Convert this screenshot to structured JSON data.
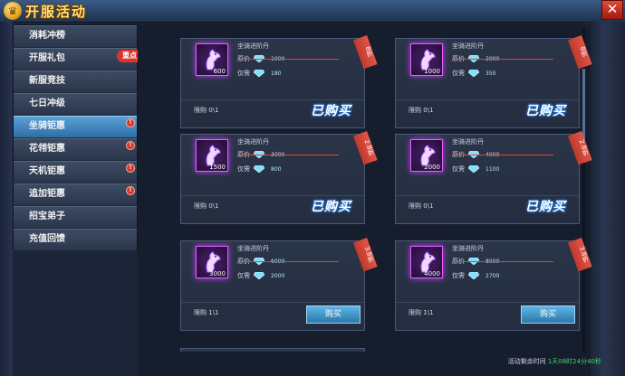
{
  "header": {
    "title": "开服活动",
    "title_icon": "crown-icon",
    "close_label": "✕"
  },
  "sidebar": {
    "items": [
      {
        "label": "消耗冲榜",
        "active": false,
        "dot": false
      },
      {
        "label": "开服礼包",
        "active": false,
        "dot": false,
        "badge": "重点"
      },
      {
        "label": "新服竞技",
        "active": false,
        "dot": false
      },
      {
        "label": "七日冲级",
        "active": false,
        "dot": false
      },
      {
        "label": "坐骑钜惠",
        "active": true,
        "dot": true
      },
      {
        "label": "花翎钜惠",
        "active": false,
        "dot": true
      },
      {
        "label": "天机钜惠",
        "active": false,
        "dot": true
      },
      {
        "label": "追加钜惠",
        "active": false,
        "dot": true
      },
      {
        "label": "招宝弟子",
        "active": false,
        "dot": false
      },
      {
        "label": "充值回馈",
        "active": false,
        "dot": false
      }
    ]
  },
  "labels": {
    "original_price": "原价",
    "now_price": "仅需",
    "bought": "已购买",
    "buy": "购买",
    "limit_prefix": "限购"
  },
  "cards": [
    {
      "name": "坐骑进阶丹",
      "count": "600",
      "original": "1000",
      "now": "180",
      "limit": "0\\1",
      "status": "bought",
      "ribbon": "8折"
    },
    {
      "name": "坐骑进阶丹",
      "count": "1000",
      "original": "2000",
      "now": "350",
      "limit": "0\\1",
      "status": "bought",
      "ribbon": "8折"
    },
    {
      "name": "坐骑进阶丹",
      "count": "1500",
      "original": "3000",
      "now": "800",
      "limit": "0\\1",
      "status": "bought",
      "ribbon": "2.8折"
    },
    {
      "name": "坐骑进阶丹",
      "count": "2000",
      "original": "4000",
      "now": "1100",
      "limit": "0\\1",
      "status": "bought",
      "ribbon": "2.8折"
    },
    {
      "name": "坐骑进阶丹",
      "count": "3000",
      "original": "6000",
      "now": "2000",
      "limit": "1\\1",
      "status": "buy",
      "ribbon": "3.8折"
    },
    {
      "name": "坐骑进阶丹",
      "count": "4000",
      "original": "8000",
      "now": "2700",
      "limit": "1\\1",
      "status": "buy",
      "ribbon": "3.8折"
    }
  ],
  "footer": {
    "timer_label": "活动剩余时间",
    "timer_value": "1天08时24分40秒"
  },
  "colors": {
    "accent": "#2e6fa6",
    "gem": "#7fe0ff",
    "ribbon": "#c0392b",
    "timer": "#3fd86a"
  }
}
